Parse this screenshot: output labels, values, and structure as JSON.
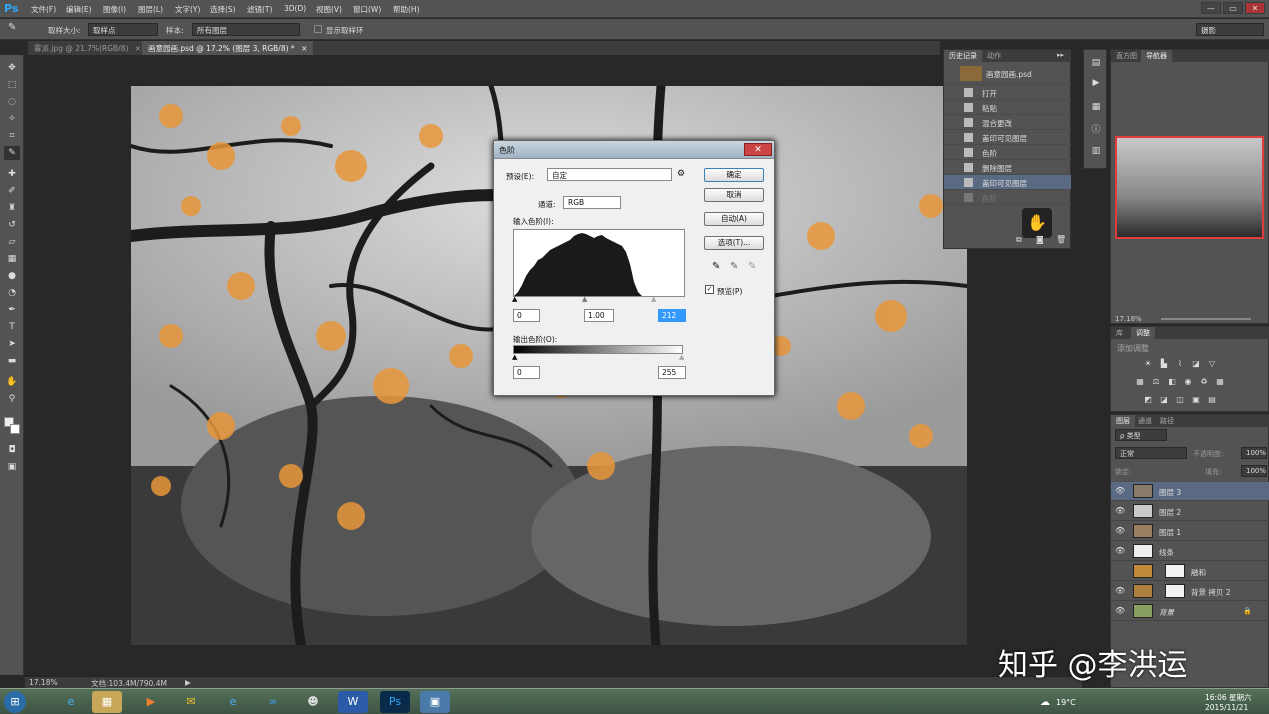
{
  "app": {
    "logo": "Ps"
  },
  "menu": [
    "文件(F)",
    "编辑(E)",
    "图像(I)",
    "图层(L)",
    "文字(Y)",
    "选择(S)",
    "滤镜(T)",
    "3D(D)",
    "视图(V)",
    "窗口(W)",
    "帮助(H)"
  ],
  "window_buttons": [
    "—",
    "▭",
    "✕"
  ],
  "options": {
    "size_label": "取样大小:",
    "size_value": "取样点",
    "sample_label": "样本:",
    "sample_value": "所有图层",
    "show_ring": "显示取样环",
    "workspace": "摄影"
  },
  "tabs": [
    {
      "label": "雾派.jpg @ 21.7%(RGB/8)",
      "close": "×"
    },
    {
      "label": "画意园画.psd @ 17.2% (图层 3, RGB/8) *",
      "close": "×"
    }
  ],
  "status": {
    "zoom": "17.18%",
    "doc": "文档:103.4M/790.4M",
    "arrow": "▶"
  },
  "levels_dialog": {
    "title": "色阶",
    "close": "✕",
    "preset_label": "预设(E):",
    "preset_value": "自定",
    "channel_label": "通道:",
    "channel_value": "RGB",
    "input_label": "输入色阶(I):",
    "input_values": [
      "0",
      "1.00",
      "212"
    ],
    "output_label": "输出色阶(O):",
    "output_values": [
      "0",
      "255"
    ],
    "buttons": {
      "ok": "确定",
      "cancel": "取消",
      "auto": "自动(A)",
      "options": "选项(T)..."
    },
    "preview": "预览(P)",
    "preview_checked": true,
    "histogram_color": "#1a1a1a"
  },
  "history_panel": {
    "tabs": [
      "历史记录",
      "动作"
    ],
    "file": "画意园画.psd",
    "items": [
      "打开",
      "粘贴",
      "混合更改",
      "盖印可见图层",
      "色阶",
      "删除图层",
      "盖印可见图层",
      "色阶"
    ]
  },
  "navigator": {
    "tabs": [
      "直方图",
      "导航器"
    ],
    "zoom": "17.18%"
  },
  "adjustments": {
    "tabs": [
      "库",
      "调整"
    ],
    "title": "添加调整"
  },
  "layers_panel": {
    "tabs": [
      "图层",
      "通道",
      "路径"
    ],
    "kind": "ρ 类型",
    "blend": "正常",
    "opacity_label": "不透明度:",
    "opacity": "100%",
    "lock_label": "锁定:",
    "fill_label": "填充:",
    "fill": "100%",
    "layers": [
      {
        "name": "图层 3",
        "visible": true,
        "selected": true
      },
      {
        "name": "图层 2",
        "visible": true,
        "selected": false
      },
      {
        "name": "图层 1",
        "visible": true,
        "selected": false
      },
      {
        "name": "线条",
        "visible": true,
        "selected": false
      },
      {
        "name": "融和",
        "visible": false,
        "selected": false
      },
      {
        "name": "背景 拷贝 2",
        "visible": true,
        "selected": false
      },
      {
        "name": "背景",
        "visible": true,
        "selected": false
      }
    ]
  },
  "taskbar": {
    "temp": "19°C",
    "time": "16:06 星期六",
    "date": "2015/11/21"
  },
  "watermark": "知乎 @李洪运"
}
